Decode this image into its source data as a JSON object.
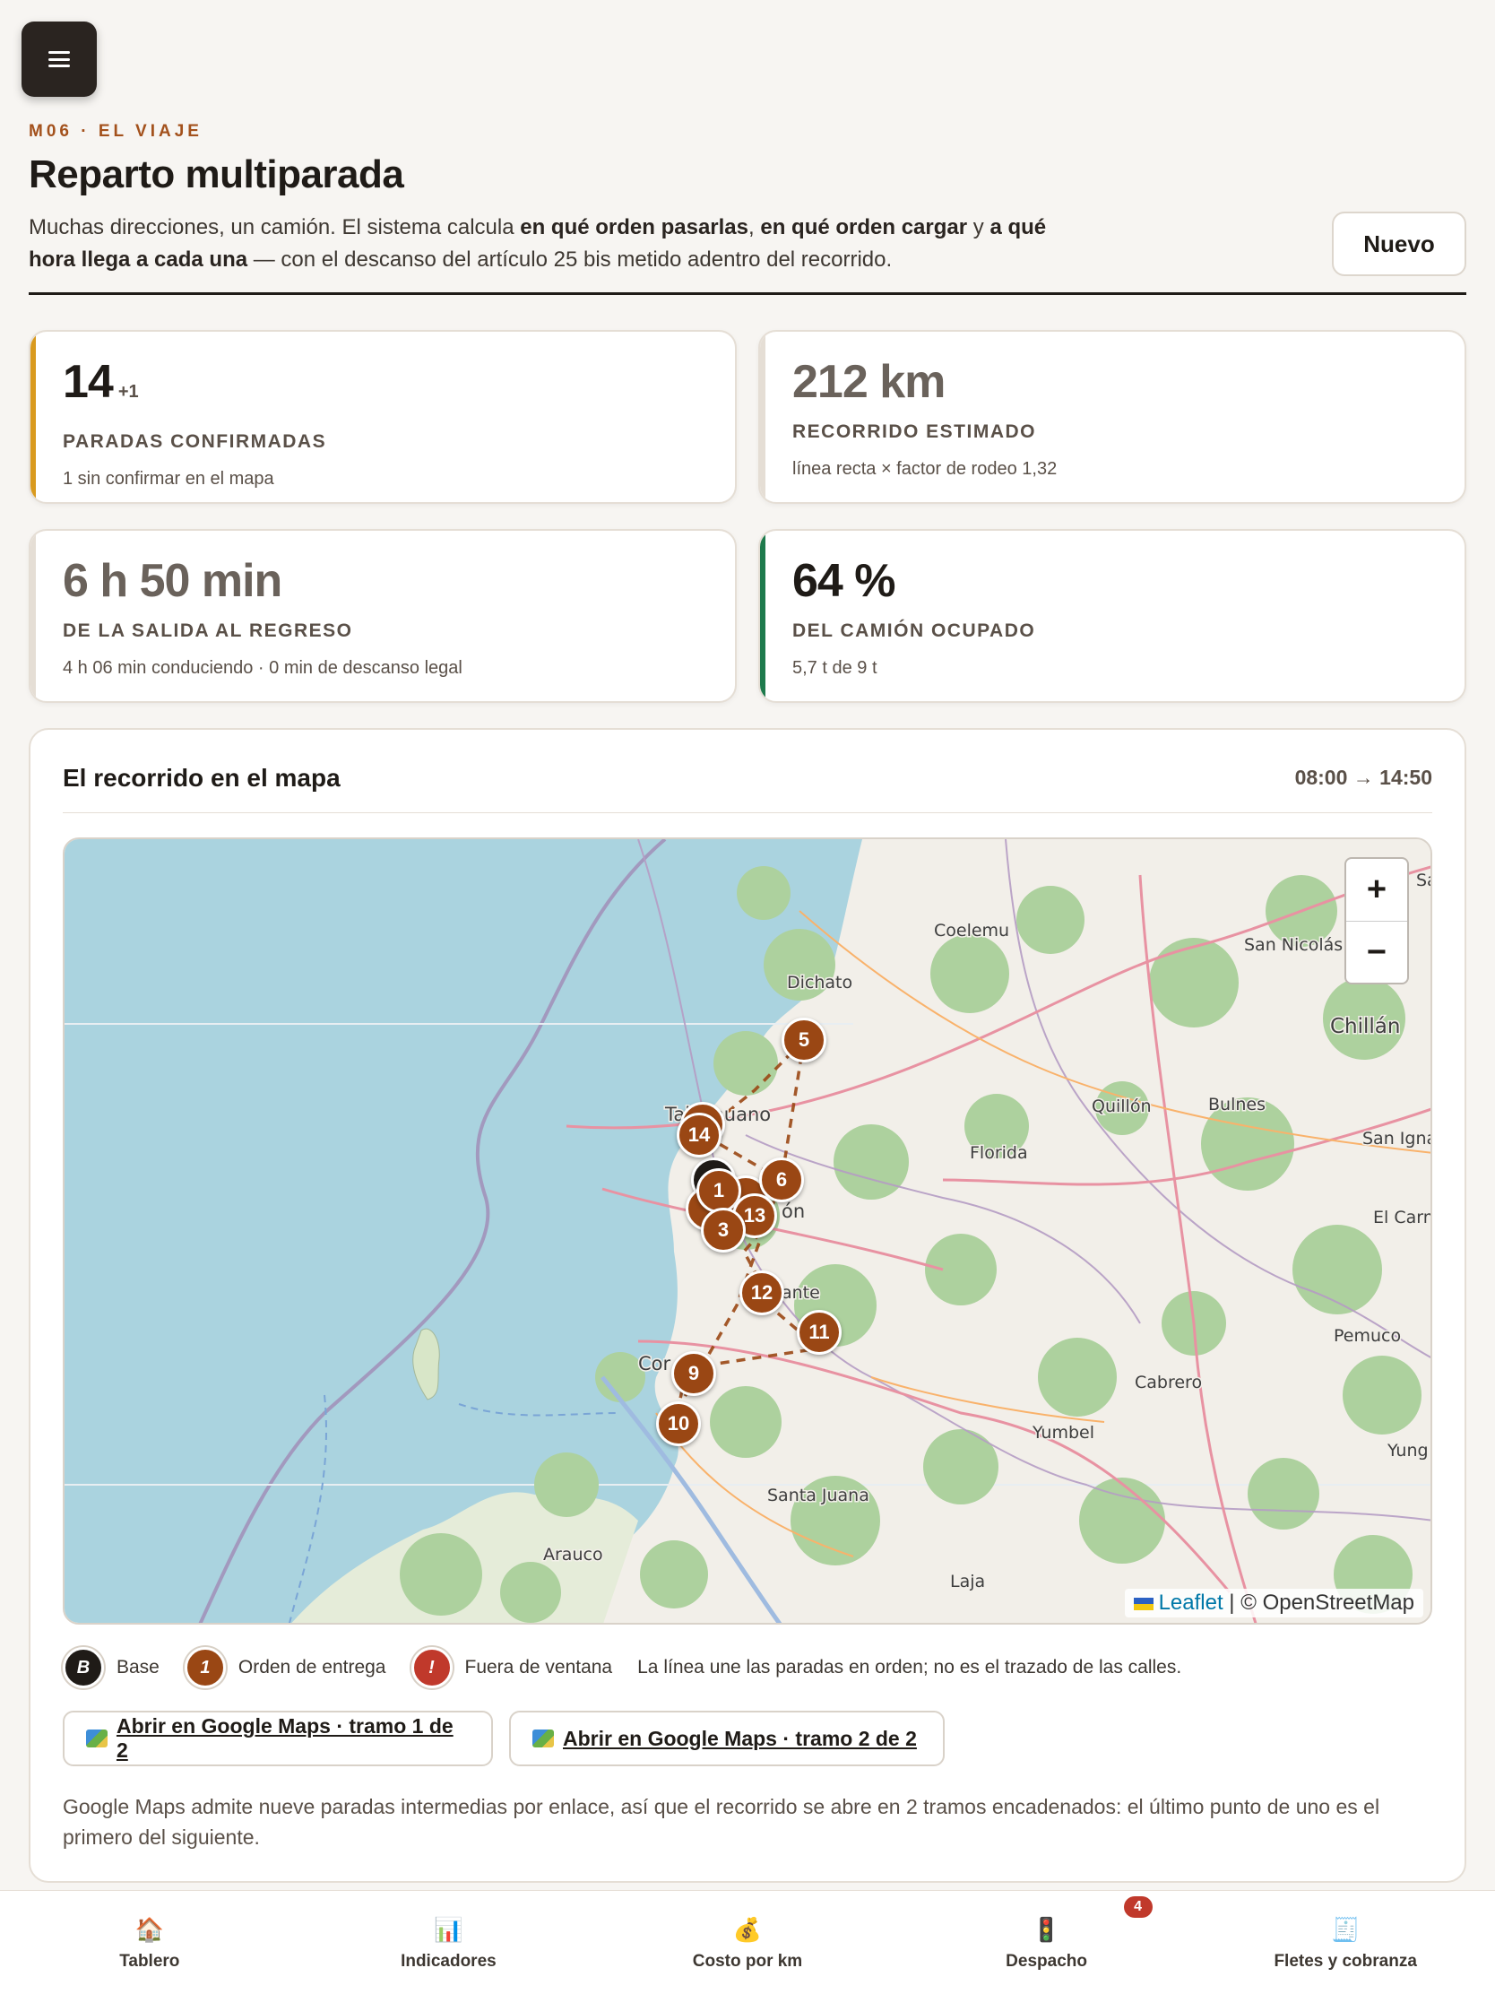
{
  "header": {
    "kicker": "M06 · EL VIAJE",
    "title": "Reparto multiparada",
    "lead_1": "Muchas direcciones, un camión. El sistema calcula ",
    "lead_b1": "en qué orden pasarlas",
    "lead_2": ", ",
    "lead_b2": "en qué orden cargar",
    "lead_3": " y ",
    "lead_b3": "a qué hora llega a cada una",
    "lead_4": " — con el descanso del artículo 25 bis metido adentro del recorrido.",
    "new_button": "Nuevo"
  },
  "kpis": {
    "stops": {
      "value": "14",
      "extra": "+1",
      "label": "PARADAS CONFIRMADAS",
      "sub": "1 sin confirmar en el mapa",
      "accent": "#d99a1e"
    },
    "distance": {
      "value": "212 km",
      "label": "RECORRIDO ESTIMADO",
      "sub": "línea recta × factor de rodeo 1,32"
    },
    "duration": {
      "value": "6 h 50 min",
      "label": "DE LA SALIDA AL REGRESO",
      "sub": "4 h 06 min conduciendo · 0 min de descanso legal"
    },
    "load": {
      "value": "64 %",
      "label": "DEL CAMIÓN OCUPADO",
      "sub": "5,7 t de 9 t",
      "accent": "#1e7a4c"
    }
  },
  "map_card": {
    "title": "El recorrido en el mapa",
    "time_range": "08:00 → 14:50",
    "zoom_in": "+",
    "zoom_out": "−",
    "attribution_leaflet": "Leaflet",
    "attribution_sep": " | ",
    "attribution_osm": "© OpenStreetMap",
    "places": {
      "coelemu": "Coelemu",
      "sannicolas": "San Nicolás",
      "dichato": "Dichato",
      "chillan": "Chillán",
      "talcahuano": "Talcahuano",
      "quillon": "Quillón",
      "bulnes": "Bulnes",
      "florida": "Florida",
      "sanignacio": "San Igna",
      "elcarmen": "El Carm",
      "pemuco": "Pemuco",
      "cabrero": "Cabrero",
      "yumbel": "Yumbel",
      "yungay": "Yung",
      "santajuana": "Santa Juana",
      "arauco": "Arauco",
      "laja": "Laja",
      "coronel": "Cor",
      "concepcion": "ón",
      "chiguayante": "ante",
      "sa": "Sa"
    },
    "stops": [
      {
        "label": "5"
      },
      {
        "label": "14"
      },
      {
        "label": "6"
      },
      {
        "label": "1"
      },
      {
        "label": "13"
      },
      {
        "label": "3"
      },
      {
        "label": "12"
      },
      {
        "label": "11"
      },
      {
        "label": "9"
      },
      {
        "label": "10"
      }
    ],
    "legend": {
      "base_mark": "B",
      "base": "Base",
      "order_mark": "1",
      "order": "Orden de entrega",
      "late_mark": "!",
      "late": "Fuera de ventana",
      "note": "La línea une las paradas en orden; no es el trazado de las calles."
    },
    "colors": {
      "base": "#1f1b17",
      "order": "#9a4714",
      "late": "#c0392b"
    },
    "gmaps_1": "Abrir en Google Maps · tramo 1 de 2",
    "gmaps_2": "Abrir en Google Maps · tramo 2 de 2",
    "note": "Google Maps admite nueve paradas intermedias por enlace, así que el recorrido se abre en 2 tramos encadenados: el último punto de uno es el primero del siguiente."
  },
  "nav": [
    {
      "label": "Tablero",
      "icon": "house-icon",
      "glyph": "🏠"
    },
    {
      "label": "Indicadores",
      "icon": "bar-chart-icon",
      "glyph": "📊"
    },
    {
      "label": "Costo por km",
      "icon": "money-bag-icon",
      "glyph": "💰"
    },
    {
      "label": "Despacho",
      "icon": "traffic-light-icon",
      "glyph": "🚦",
      "badge": "4"
    },
    {
      "label": "Fletes y cobranza",
      "icon": "receipt-icon",
      "glyph": "🧾"
    }
  ]
}
